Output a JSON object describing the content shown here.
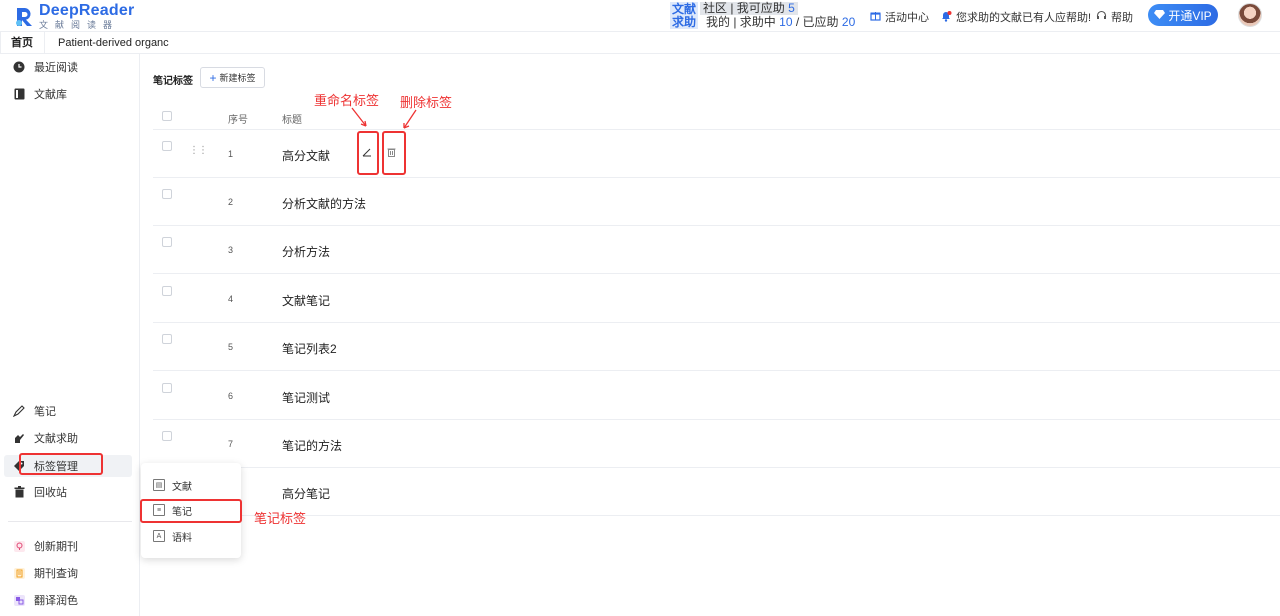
{
  "header": {
    "logo_title": "DeepReader",
    "logo_subtitle": "文献阅读器",
    "help_tag_line1": "文献",
    "help_tag_line2": "求助",
    "community_text": "社区 | 我可应助",
    "community_count": "5",
    "mine_text": "我的 | 求助中",
    "mine_pending": "10",
    "slash": "/",
    "answered_text": "已应助",
    "answered_count": "20",
    "activity_center": "活动中心",
    "notice_text": "您求助的文献已有人应帮助!",
    "help_label": "帮助",
    "vip_button": "开通VIP"
  },
  "tabs": [
    {
      "label": "首页"
    },
    {
      "label": "Patient-derived organc"
    }
  ],
  "sidebar": {
    "top_items": [
      {
        "label": "最近阅读",
        "icon": "clock-icon"
      },
      {
        "label": "文献库",
        "icon": "book-icon"
      }
    ],
    "mid_items": [
      {
        "label": "笔记",
        "icon": "pen-icon"
      },
      {
        "label": "文献求助",
        "icon": "hand-icon"
      },
      {
        "label": "标签管理",
        "icon": "tag-icon"
      },
      {
        "label": "回收站",
        "icon": "trash-icon"
      }
    ],
    "bottom_items": [
      {
        "label": "创新期刊",
        "icon": "bulb-icon"
      },
      {
        "label": "期刊查询",
        "icon": "journal-icon"
      },
      {
        "label": "翻译润色",
        "icon": "translate-icon"
      }
    ]
  },
  "main": {
    "section_title": "笔记标签",
    "new_tag_button": "新建标签",
    "columns": {
      "index": "序号",
      "title": "标题"
    },
    "rows": [
      {
        "index": "1",
        "title": "高分文献"
      },
      {
        "index": "2",
        "title": "分析文献的方法"
      },
      {
        "index": "3",
        "title": "分析方法"
      },
      {
        "index": "4",
        "title": "文献笔记"
      },
      {
        "index": "5",
        "title": "笔记列表2"
      },
      {
        "index": "6",
        "title": "笔记测试"
      },
      {
        "index": "7",
        "title": "笔记的方法"
      },
      {
        "index": "",
        "title": "高分笔记"
      }
    ]
  },
  "popup_menu": [
    {
      "label": "文献",
      "icon": "document-icon"
    },
    {
      "label": "笔记",
      "icon": "note-icon"
    },
    {
      "label": "语料",
      "icon": "corpus-icon"
    }
  ],
  "annotations": {
    "rename_tag": "重命名标签",
    "delete_tag": "删除标签",
    "note_tag": "笔记标签",
    "color": "#e33333"
  },
  "colors": {
    "brand": "#2d6be4",
    "annotation": "#e33333"
  }
}
